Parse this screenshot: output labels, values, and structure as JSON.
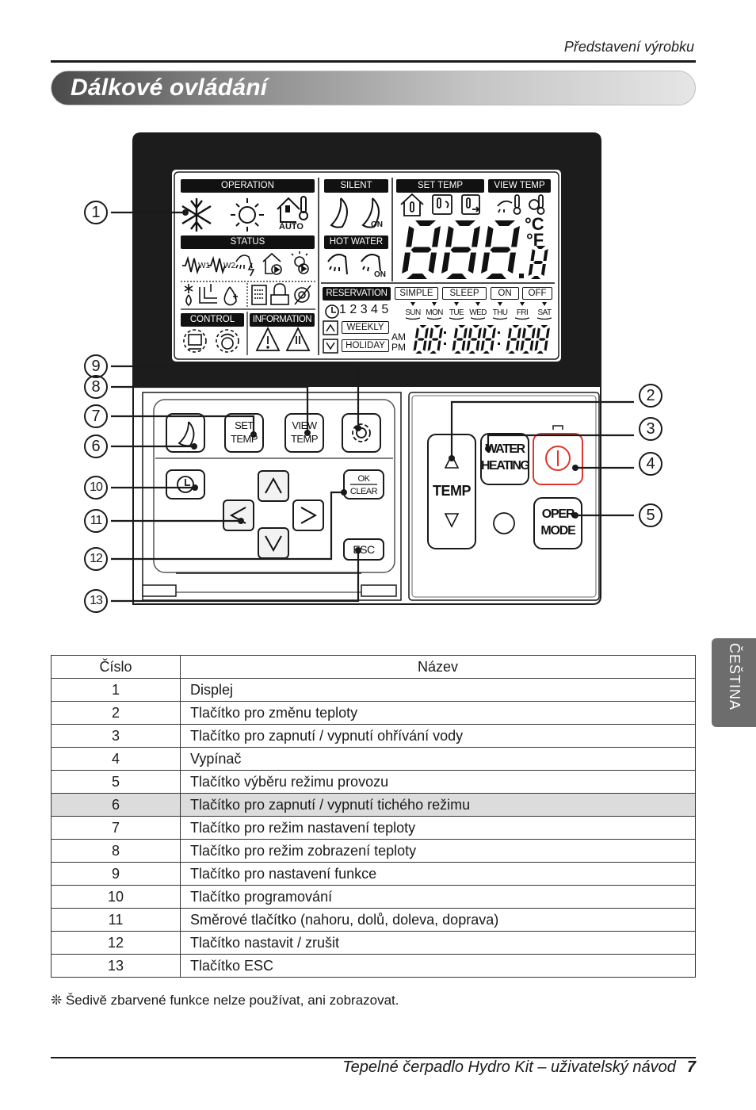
{
  "header": {
    "section": "Představení výrobku",
    "title": "Dálkové ovládání"
  },
  "language_tab": "ČEŠTINA",
  "remote": {
    "callouts": [
      "1",
      "2",
      "3",
      "4",
      "5",
      "6",
      "7",
      "8",
      "9",
      "10",
      "11",
      "12",
      "13"
    ],
    "lcd": {
      "operation": "OPERATION",
      "auto": "AUTO",
      "status": "STATUS",
      "control": "CONTROL",
      "information": "INFORMATION",
      "silent": "SILENT",
      "on": "ON",
      "hot_water": "HOT WATER",
      "set_temp": "SET TEMP",
      "view_temp": "VIEW TEMP",
      "celsius": "°C",
      "fahrenheit": "°F",
      "main_digits": "888",
      "main_decimal": ".8",
      "reservation": "RESERVATION",
      "simple": "SIMPLE",
      "sleep": "SLEEP",
      "res_on": "ON",
      "res_off": "OFF",
      "slots": "1 2 3 4 5",
      "weekly": "WEEKLY",
      "holiday": "HOLIDAY",
      "am": "AM",
      "pm": "PM",
      "clock_digits": "88:888:888",
      "days": [
        "SUN",
        "MON",
        "TUE",
        "WED",
        "THU",
        "FRI",
        "SAT"
      ],
      "w1": "W1",
      "w2": "W2"
    },
    "buttons": {
      "set_temp": [
        "SET",
        "TEMP"
      ],
      "view_temp": [
        "VIEW",
        "TEMP"
      ],
      "ok": "OK",
      "clear": "CLEAR",
      "esc": "ESC",
      "temp": "TEMP",
      "water_heating": [
        "WATER",
        "HEATING"
      ],
      "oper_mode": [
        "OPER",
        "MODE"
      ]
    },
    "colors": {
      "power_button": "#e0362b",
      "lcd_frame": "#1c1c1c"
    }
  },
  "table": {
    "headers": [
      "Číslo",
      "Název"
    ],
    "rows": [
      {
        "num": "1",
        "name": "Displej"
      },
      {
        "num": "2",
        "name": "Tlačítko pro změnu teploty"
      },
      {
        "num": "3",
        "name": "Tlačítko pro zapnutí / vypnutí ohřívání vody"
      },
      {
        "num": "4",
        "name": "Vypínač"
      },
      {
        "num": "5",
        "name": "Tlačítko výběru režimu provozu"
      },
      {
        "num": "6",
        "name": "Tlačítko pro zapnutí / vypnutí tichého režimu"
      },
      {
        "num": "7",
        "name": "Tlačítko pro režim nastavení teploty"
      },
      {
        "num": "8",
        "name": "Tlačítko pro režim zobrazení teploty"
      },
      {
        "num": "9",
        "name": "Tlačítko pro nastavení funkce"
      },
      {
        "num": "10",
        "name": "Tlačítko programování"
      },
      {
        "num": "11",
        "name": "Směrové tlačítko (nahoru, dolů, doleva, doprava)"
      },
      {
        "num": "12",
        "name": "Tlačítko nastavit / zrušit"
      },
      {
        "num": "13",
        "name": "Tlačítko ESC"
      }
    ],
    "shaded_row": "6"
  },
  "note": "❊ Šedivě zbarvené funkce nelze používat, ani zobrazovat.",
  "footer": {
    "text": "Tepelné čerpadlo Hydro Kit – uživatelský návod",
    "page": "7"
  }
}
